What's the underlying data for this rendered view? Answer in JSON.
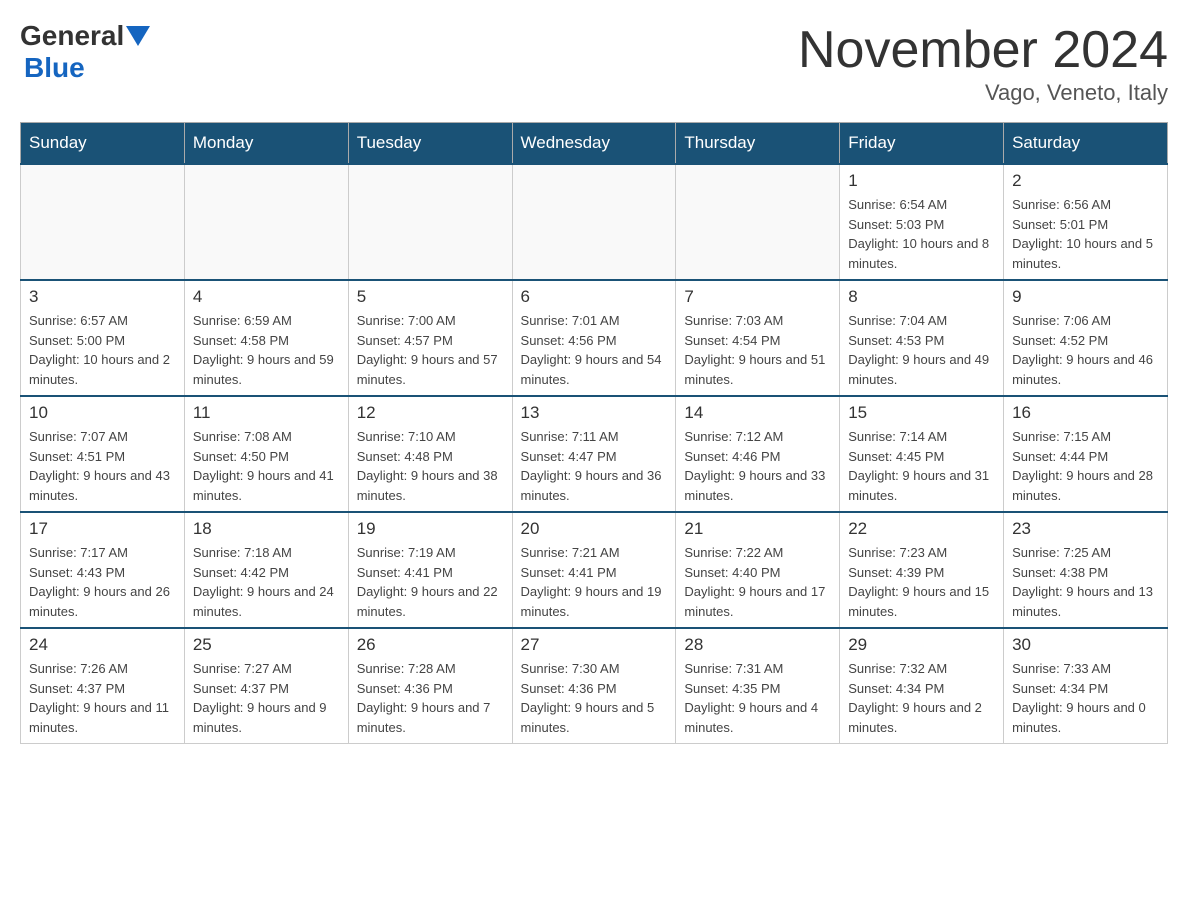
{
  "header": {
    "logo": {
      "general": "General",
      "blue": "Blue"
    },
    "title": "November 2024",
    "location": "Vago, Veneto, Italy"
  },
  "weekdays": [
    "Sunday",
    "Monday",
    "Tuesday",
    "Wednesday",
    "Thursday",
    "Friday",
    "Saturday"
  ],
  "weeks": [
    [
      {
        "day": "",
        "sunrise": "",
        "sunset": "",
        "daylight": ""
      },
      {
        "day": "",
        "sunrise": "",
        "sunset": "",
        "daylight": ""
      },
      {
        "day": "",
        "sunrise": "",
        "sunset": "",
        "daylight": ""
      },
      {
        "day": "",
        "sunrise": "",
        "sunset": "",
        "daylight": ""
      },
      {
        "day": "",
        "sunrise": "",
        "sunset": "",
        "daylight": ""
      },
      {
        "day": "1",
        "sunrise": "Sunrise: 6:54 AM",
        "sunset": "Sunset: 5:03 PM",
        "daylight": "Daylight: 10 hours and 8 minutes."
      },
      {
        "day": "2",
        "sunrise": "Sunrise: 6:56 AM",
        "sunset": "Sunset: 5:01 PM",
        "daylight": "Daylight: 10 hours and 5 minutes."
      }
    ],
    [
      {
        "day": "3",
        "sunrise": "Sunrise: 6:57 AM",
        "sunset": "Sunset: 5:00 PM",
        "daylight": "Daylight: 10 hours and 2 minutes."
      },
      {
        "day": "4",
        "sunrise": "Sunrise: 6:59 AM",
        "sunset": "Sunset: 4:58 PM",
        "daylight": "Daylight: 9 hours and 59 minutes."
      },
      {
        "day": "5",
        "sunrise": "Sunrise: 7:00 AM",
        "sunset": "Sunset: 4:57 PM",
        "daylight": "Daylight: 9 hours and 57 minutes."
      },
      {
        "day": "6",
        "sunrise": "Sunrise: 7:01 AM",
        "sunset": "Sunset: 4:56 PM",
        "daylight": "Daylight: 9 hours and 54 minutes."
      },
      {
        "day": "7",
        "sunrise": "Sunrise: 7:03 AM",
        "sunset": "Sunset: 4:54 PM",
        "daylight": "Daylight: 9 hours and 51 minutes."
      },
      {
        "day": "8",
        "sunrise": "Sunrise: 7:04 AM",
        "sunset": "Sunset: 4:53 PM",
        "daylight": "Daylight: 9 hours and 49 minutes."
      },
      {
        "day": "9",
        "sunrise": "Sunrise: 7:06 AM",
        "sunset": "Sunset: 4:52 PM",
        "daylight": "Daylight: 9 hours and 46 minutes."
      }
    ],
    [
      {
        "day": "10",
        "sunrise": "Sunrise: 7:07 AM",
        "sunset": "Sunset: 4:51 PM",
        "daylight": "Daylight: 9 hours and 43 minutes."
      },
      {
        "day": "11",
        "sunrise": "Sunrise: 7:08 AM",
        "sunset": "Sunset: 4:50 PM",
        "daylight": "Daylight: 9 hours and 41 minutes."
      },
      {
        "day": "12",
        "sunrise": "Sunrise: 7:10 AM",
        "sunset": "Sunset: 4:48 PM",
        "daylight": "Daylight: 9 hours and 38 minutes."
      },
      {
        "day": "13",
        "sunrise": "Sunrise: 7:11 AM",
        "sunset": "Sunset: 4:47 PM",
        "daylight": "Daylight: 9 hours and 36 minutes."
      },
      {
        "day": "14",
        "sunrise": "Sunrise: 7:12 AM",
        "sunset": "Sunset: 4:46 PM",
        "daylight": "Daylight: 9 hours and 33 minutes."
      },
      {
        "day": "15",
        "sunrise": "Sunrise: 7:14 AM",
        "sunset": "Sunset: 4:45 PM",
        "daylight": "Daylight: 9 hours and 31 minutes."
      },
      {
        "day": "16",
        "sunrise": "Sunrise: 7:15 AM",
        "sunset": "Sunset: 4:44 PM",
        "daylight": "Daylight: 9 hours and 28 minutes."
      }
    ],
    [
      {
        "day": "17",
        "sunrise": "Sunrise: 7:17 AM",
        "sunset": "Sunset: 4:43 PM",
        "daylight": "Daylight: 9 hours and 26 minutes."
      },
      {
        "day": "18",
        "sunrise": "Sunrise: 7:18 AM",
        "sunset": "Sunset: 4:42 PM",
        "daylight": "Daylight: 9 hours and 24 minutes."
      },
      {
        "day": "19",
        "sunrise": "Sunrise: 7:19 AM",
        "sunset": "Sunset: 4:41 PM",
        "daylight": "Daylight: 9 hours and 22 minutes."
      },
      {
        "day": "20",
        "sunrise": "Sunrise: 7:21 AM",
        "sunset": "Sunset: 4:41 PM",
        "daylight": "Daylight: 9 hours and 19 minutes."
      },
      {
        "day": "21",
        "sunrise": "Sunrise: 7:22 AM",
        "sunset": "Sunset: 4:40 PM",
        "daylight": "Daylight: 9 hours and 17 minutes."
      },
      {
        "day": "22",
        "sunrise": "Sunrise: 7:23 AM",
        "sunset": "Sunset: 4:39 PM",
        "daylight": "Daylight: 9 hours and 15 minutes."
      },
      {
        "day": "23",
        "sunrise": "Sunrise: 7:25 AM",
        "sunset": "Sunset: 4:38 PM",
        "daylight": "Daylight: 9 hours and 13 minutes."
      }
    ],
    [
      {
        "day": "24",
        "sunrise": "Sunrise: 7:26 AM",
        "sunset": "Sunset: 4:37 PM",
        "daylight": "Daylight: 9 hours and 11 minutes."
      },
      {
        "day": "25",
        "sunrise": "Sunrise: 7:27 AM",
        "sunset": "Sunset: 4:37 PM",
        "daylight": "Daylight: 9 hours and 9 minutes."
      },
      {
        "day": "26",
        "sunrise": "Sunrise: 7:28 AM",
        "sunset": "Sunset: 4:36 PM",
        "daylight": "Daylight: 9 hours and 7 minutes."
      },
      {
        "day": "27",
        "sunrise": "Sunrise: 7:30 AM",
        "sunset": "Sunset: 4:36 PM",
        "daylight": "Daylight: 9 hours and 5 minutes."
      },
      {
        "day": "28",
        "sunrise": "Sunrise: 7:31 AM",
        "sunset": "Sunset: 4:35 PM",
        "daylight": "Daylight: 9 hours and 4 minutes."
      },
      {
        "day": "29",
        "sunrise": "Sunrise: 7:32 AM",
        "sunset": "Sunset: 4:34 PM",
        "daylight": "Daylight: 9 hours and 2 minutes."
      },
      {
        "day": "30",
        "sunrise": "Sunrise: 7:33 AM",
        "sunset": "Sunset: 4:34 PM",
        "daylight": "Daylight: 9 hours and 0 minutes."
      }
    ]
  ]
}
